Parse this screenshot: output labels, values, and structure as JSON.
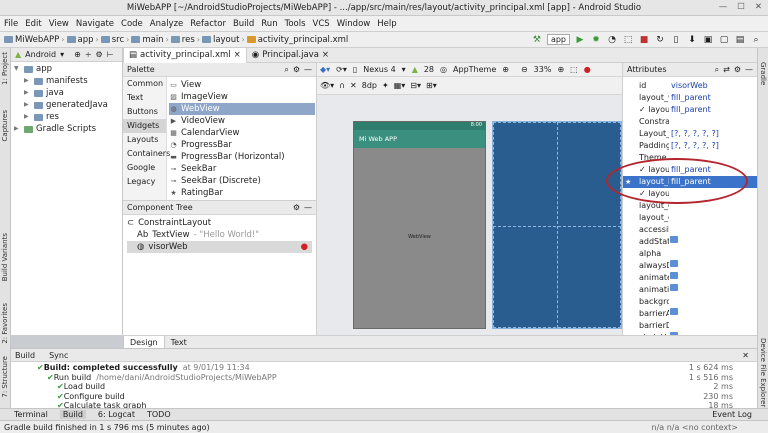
{
  "window": {
    "title": "MiWebAPP [~/AndroidStudioProjects/MiWebAPP] - .../app/src/main/res/layout/activity_principal.xml [app] - Android Studio"
  },
  "menu": [
    "File",
    "Edit",
    "View",
    "Navigate",
    "Code",
    "Analyze",
    "Refactor",
    "Build",
    "Run",
    "Tools",
    "VCS",
    "Window",
    "Help"
  ],
  "breadcrumb": [
    "MiWebAPP",
    "app",
    "src",
    "main",
    "res",
    "layout",
    "activity_principal.xml"
  ],
  "toolbar": {
    "run_config": "app"
  },
  "left_strip": {
    "project": "1: Project",
    "captures": "Captures",
    "build_variants": "Build Variants",
    "favorites": "2: Favorites",
    "structure": "7: Structure"
  },
  "right_strip": {
    "gradle": "Gradle",
    "device_explorer": "Device File Explorer"
  },
  "project": {
    "view_mode": "Android",
    "items": [
      {
        "label": "app",
        "level": 0
      },
      {
        "label": "manifests",
        "level": 1
      },
      {
        "label": "java",
        "level": 1
      },
      {
        "label": "generatedJava",
        "level": 1
      },
      {
        "label": "res",
        "level": 1
      },
      {
        "label": "Gradle Scripts",
        "level": 0
      }
    ]
  },
  "tabs": [
    {
      "label": "activity_principal.xml",
      "active": true
    },
    {
      "label": "Principal.java",
      "active": false
    }
  ],
  "palette": {
    "title": "Palette",
    "categories": [
      "Common",
      "Text",
      "Buttons",
      "Widgets",
      "Layouts",
      "Containers",
      "Google",
      "Legacy"
    ],
    "selected_category": "Widgets",
    "widgets": [
      "View",
      "ImageView",
      "WebView",
      "VideoView",
      "CalendarView",
      "ProgressBar",
      "ProgressBar (Horizontal)",
      "SeekBar",
      "SeekBar (Discrete)",
      "RatingBar"
    ],
    "highlighted": "WebView"
  },
  "component_tree": {
    "title": "Component Tree",
    "items": [
      {
        "label": "ConstraintLayout",
        "note": ""
      },
      {
        "label": "TextView",
        "note": "- \"Hello World!\""
      },
      {
        "label": "visorWeb",
        "note": ""
      }
    ]
  },
  "design_toolbar": {
    "device": "Nexus 4",
    "api": "28",
    "theme": "AppTheme",
    "zoom": "33%"
  },
  "phone": {
    "app_title": "Mi Web APP",
    "status_time": "8:00",
    "webview_label": "WebView"
  },
  "attributes": {
    "title": "Attributes",
    "rows": [
      {
        "k": "id",
        "v": "visorWeb"
      },
      {
        "k": "layout_width",
        "v": "fill_parent"
      },
      {
        "k": "✓ layout_wi",
        "v": "fill_parent"
      },
      {
        "k": "Constraints",
        "v": ""
      },
      {
        "k": "Layout_Mar",
        "v": "[?, ?, ?, ?, ?]"
      },
      {
        "k": "Padding",
        "v": "[?, ?, ?, ?, ?]"
      },
      {
        "k": "Theme",
        "v": ""
      },
      {
        "k": "✓ layout_wi",
        "v": "fill_parent"
      },
      {
        "k": "layout_heig",
        "v": "fill_parent",
        "selected": true
      },
      {
        "k": "✓ layout_he",
        "v": ""
      },
      {
        "k": "layout_edito",
        "v": ""
      },
      {
        "k": "layout_edito",
        "v": ""
      },
      {
        "k": "accessibility",
        "v": ""
      },
      {
        "k": "addStatesFr",
        "v": "box"
      },
      {
        "k": "alpha",
        "v": ""
      },
      {
        "k": "alwaysDraw",
        "v": "box"
      },
      {
        "k": "animateLay",
        "v": "box"
      },
      {
        "k": "animationC",
        "v": "box"
      },
      {
        "k": "background",
        "v": ""
      },
      {
        "k": "barrierAllov",
        "v": "box"
      },
      {
        "k": "barrierDirec",
        "v": ""
      },
      {
        "k": "chainUseRtl",
        "v": "box"
      }
    ]
  },
  "design_tabs": [
    "Design",
    "Text"
  ],
  "build": {
    "tabs": [
      "Build",
      "Sync"
    ],
    "rows": [
      {
        "text": "Build: completed successfully",
        "sub": "at 9/01/19 11:34",
        "time": "1 s 624 ms"
      },
      {
        "text": "Run build",
        "sub": "/home/dani/AndroidStudioProjects/MiWebAPP",
        "time": "1 s 516 ms"
      },
      {
        "text": "Load build",
        "sub": "",
        "time": "2 ms"
      },
      {
        "text": "Configure build",
        "sub": "",
        "time": "230 ms"
      },
      {
        "text": "Calculate task graph",
        "sub": "",
        "time": "18 ms"
      }
    ]
  },
  "bottom_tabs": [
    "Terminal",
    "Build",
    "6: Logcat",
    "TODO"
  ],
  "event_log": "Event Log",
  "status": {
    "message": "Gradle build finished in 1 s 796 ms (5 minutes ago)",
    "context": "n/a  n/a  <no context>"
  }
}
